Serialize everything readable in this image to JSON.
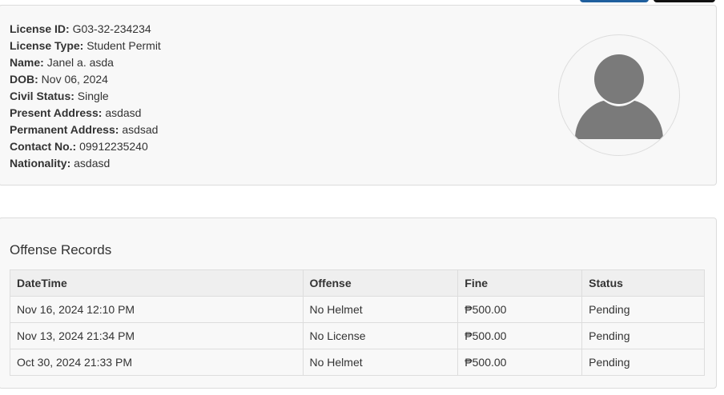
{
  "profile": {
    "fields": [
      {
        "label": "License ID:",
        "value": "G03-32-234234"
      },
      {
        "label": "License Type:",
        "value": "Student Permit"
      },
      {
        "label": "Name:",
        "value": "Janel a. asda"
      },
      {
        "label": "DOB:",
        "value": "Nov 06, 2024"
      },
      {
        "label": "Civil Status:",
        "value": "Single"
      },
      {
        "label": "Present Address:",
        "value": "asdasd"
      },
      {
        "label": "Permanent Address:",
        "value": "asdsad"
      },
      {
        "label": "Contact No.:",
        "value": "09912235240"
      },
      {
        "label": "Nationality:",
        "value": "asdasd"
      }
    ],
    "avatar_icon": "user-silhouette-icon"
  },
  "offenses": {
    "title": "Offense Records",
    "columns": [
      "DateTime",
      "Offense",
      "Fine",
      "Status"
    ],
    "rows": [
      [
        "Nov 16, 2024 12:10 PM",
        "No Helmet",
        "₱500.00",
        "Pending"
      ],
      [
        "Nov 13, 2024 21:34 PM",
        "No License",
        "₱500.00",
        "Pending"
      ],
      [
        "Oct 30, 2024 21:33 PM",
        "No Helmet",
        "₱500.00",
        "Pending"
      ]
    ]
  },
  "colors": {
    "primary_button": "#1f5f9e",
    "dark_button": "#111111",
    "card_background": "#f8f8f8",
    "avatar_gray": "#7a7a7a"
  }
}
